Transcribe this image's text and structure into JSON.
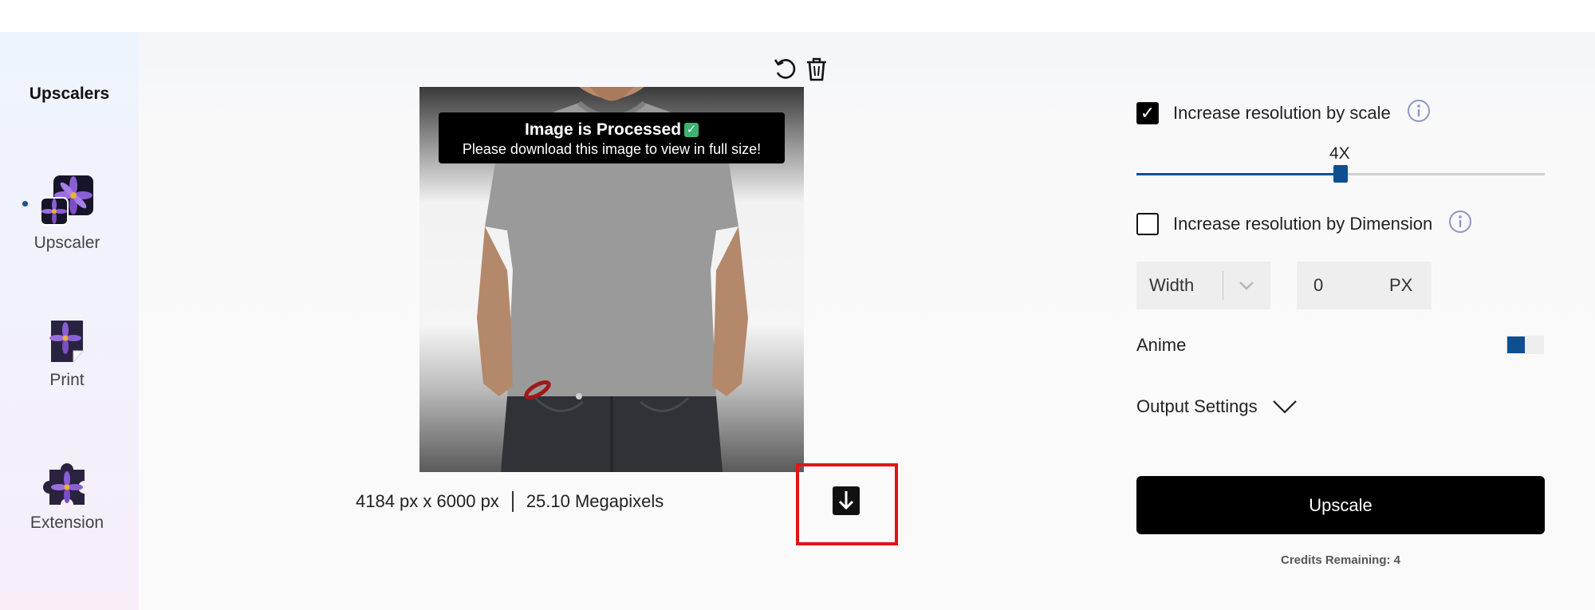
{
  "sidebar": {
    "title": "Upscalers",
    "items": [
      {
        "label": "Upscaler",
        "icon": "upscaler-flower-icon"
      },
      {
        "label": "Print",
        "icon": "print-flower-icon"
      },
      {
        "label": "Extension",
        "icon": "extension-puzzle-icon"
      }
    ]
  },
  "preview": {
    "banner_title": "Image is Processed",
    "banner_subtitle": "Please download this image to view in full size!",
    "dimensions": "4184 px x 6000 px",
    "megapixels": "25.10 Megapixels"
  },
  "settings": {
    "scale_label": "Increase resolution by scale",
    "scale_checked": true,
    "scale_value": "4X",
    "scale_fraction": 0.5,
    "dimension_label": "Increase resolution by Dimension",
    "dimension_checked": false,
    "dimension_select": "Width",
    "dimension_value": "0",
    "dimension_unit": "PX",
    "anime_label": "Anime",
    "anime_on": false,
    "output_label": "Output Settings"
  },
  "actions": {
    "upscale_label": "Upscale",
    "credits": "Credits Remaining: 4"
  },
  "colors": {
    "accent": "#0e4f8f",
    "highlight": "#e0141a",
    "button": "#000000"
  }
}
